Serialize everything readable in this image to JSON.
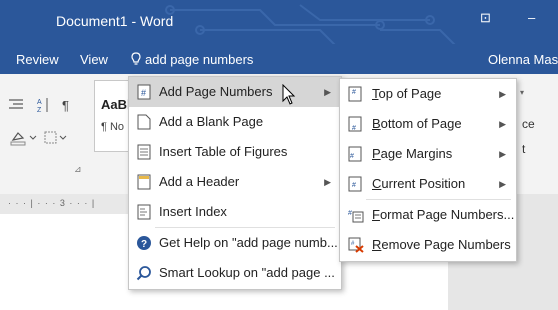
{
  "window": {
    "title": "Document1 - Word",
    "restore_glyph": "⊡",
    "minimize_glyph": "–",
    "brand_color": "#2b579a"
  },
  "tabs": {
    "review": "Review",
    "view": "View",
    "tell_me_icon": "lightbulb-icon",
    "tell_me_text": "add page numbers",
    "user_name": "Olenna Mason"
  },
  "ribbon": {
    "style_preview": "AaBl",
    "style_sub": "¶ No",
    "ruler_text": "· · · | · · · 3 · · · |",
    "right_frag_1": "ce",
    "right_frag_2": "t",
    "dialog_launcher": "⊿"
  },
  "menu_main": {
    "items": [
      {
        "label": "Add Page Numbers",
        "icon": "page-number-icon",
        "submenu": true
      },
      {
        "label": "Add a Blank Page",
        "icon": "blank-page-icon",
        "submenu": false
      },
      {
        "label": "Insert Table of Figures",
        "icon": "table-of-figures-icon",
        "submenu": false
      },
      {
        "label": "Add a Header",
        "icon": "header-icon",
        "submenu": true
      },
      {
        "label": "Insert Index",
        "icon": "index-icon",
        "submenu": false
      },
      {
        "label": "Get Help on \"add page numb...",
        "icon": "help-icon",
        "submenu": false
      },
      {
        "label": "Smart Lookup on \"add page ...",
        "icon": "smart-lookup-icon",
        "submenu": false
      }
    ]
  },
  "menu_sub": {
    "items": [
      {
        "label": "Top of Page",
        "icon": "top-of-page-icon",
        "submenu": true
      },
      {
        "label": "Bottom of Page",
        "icon": "bottom-of-page-icon",
        "submenu": true
      },
      {
        "label": "Page Margins",
        "icon": "page-margins-icon",
        "submenu": true
      },
      {
        "label": "Current Position",
        "icon": "current-position-icon",
        "submenu": true
      },
      {
        "label": "Format Page Numbers...",
        "icon": "format-page-numbers-icon",
        "submenu": false
      },
      {
        "label": "Remove Page Numbers",
        "icon": "remove-page-numbers-icon",
        "submenu": false
      }
    ]
  }
}
